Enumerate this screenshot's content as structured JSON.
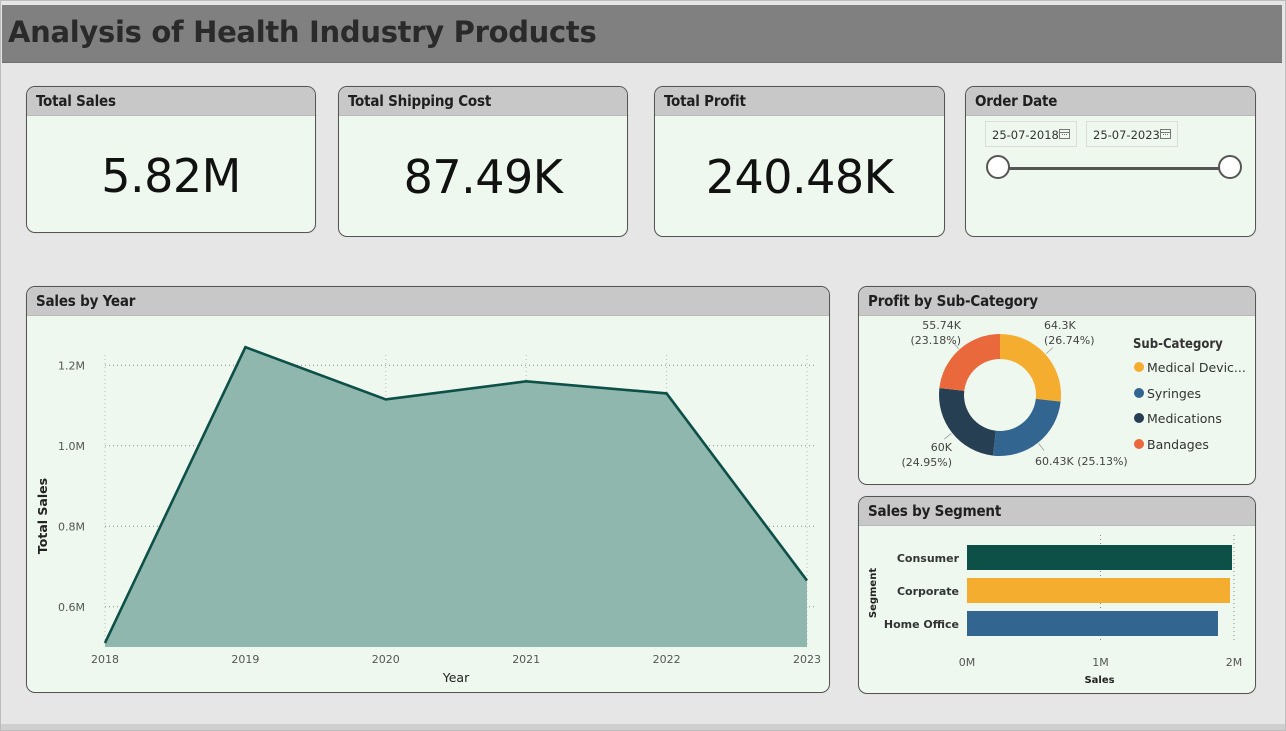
{
  "header": {
    "title": "Analysis of Health Industry Products"
  },
  "kpis": [
    {
      "label": "Total Sales",
      "value": "5.82M"
    },
    {
      "label": "Total Shipping Cost",
      "value": "87.49K"
    },
    {
      "label": "Total Profit",
      "value": "240.48K"
    }
  ],
  "order_date": {
    "label": "Order Date",
    "start": "25-07-2018",
    "end": "25-07-2023"
  },
  "colors": {
    "area_fill": "#8fb7ad",
    "area_line": "#0d5048",
    "medical_devices": "#f5ad2f",
    "syringes": "#32658f",
    "medications": "#273f52",
    "bandages": "#e9693c",
    "consumer": "#0d5048",
    "corporate": "#f5ad2f",
    "home_office": "#32658f"
  },
  "chart_data": [
    {
      "type": "area",
      "title": "Sales by Year",
      "xlabel": "Year",
      "ylabel": "Total Sales",
      "x": [
        2018,
        2019,
        2020,
        2021,
        2022,
        2023
      ],
      "x_tick_labels": [
        "2018",
        "2019",
        "2020",
        "2021",
        "2022",
        "2023"
      ],
      "y_tick_values": [
        600000,
        800000,
        1000000,
        1200000
      ],
      "y_tick_labels": [
        "0.6M",
        "0.8M",
        "1.0M",
        "1.2M"
      ],
      "series": [
        {
          "values": [
            510000,
            1245000,
            1115000,
            1160000,
            1130000,
            665000
          ]
        }
      ],
      "ylim": [
        500000,
        1300000
      ],
      "grid": true
    },
    {
      "type": "pie",
      "title": "Profit by Sub-Category",
      "legend_title": "Sub-Category",
      "legend_position": "right",
      "slices": [
        {
          "name": "Medical Devic...",
          "value": 64300,
          "label_value": "64.3K",
          "label_pct": "(26.74%)",
          "color_key": "medical_devices"
        },
        {
          "name": "Syringes",
          "value": 60430,
          "label_value": "60.43K (25.13%)",
          "label_pct": "",
          "color_key": "syringes"
        },
        {
          "name": "Medications",
          "value": 60000,
          "label_value": "60K",
          "label_pct": "(24.95%)",
          "color_key": "medications"
        },
        {
          "name": "Bandages",
          "value": 55740,
          "label_value": "55.74K",
          "label_pct": "(23.18%)",
          "color_key": "bandages"
        }
      ]
    },
    {
      "type": "bar",
      "orientation": "horizontal",
      "title": "Sales by Segment",
      "xlabel": "Sales",
      "ylabel": "Segment",
      "categories": [
        "Consumer",
        "Corporate",
        "Home Office"
      ],
      "values": [
        1985000,
        1970000,
        1880000
      ],
      "x_tick_values": [
        0,
        1000000,
        2000000
      ],
      "x_tick_labels": [
        "0M",
        "1M",
        "2M"
      ],
      "xlim": [
        0,
        2000000
      ],
      "colors": [
        "consumer",
        "corporate",
        "home_office"
      ]
    }
  ]
}
